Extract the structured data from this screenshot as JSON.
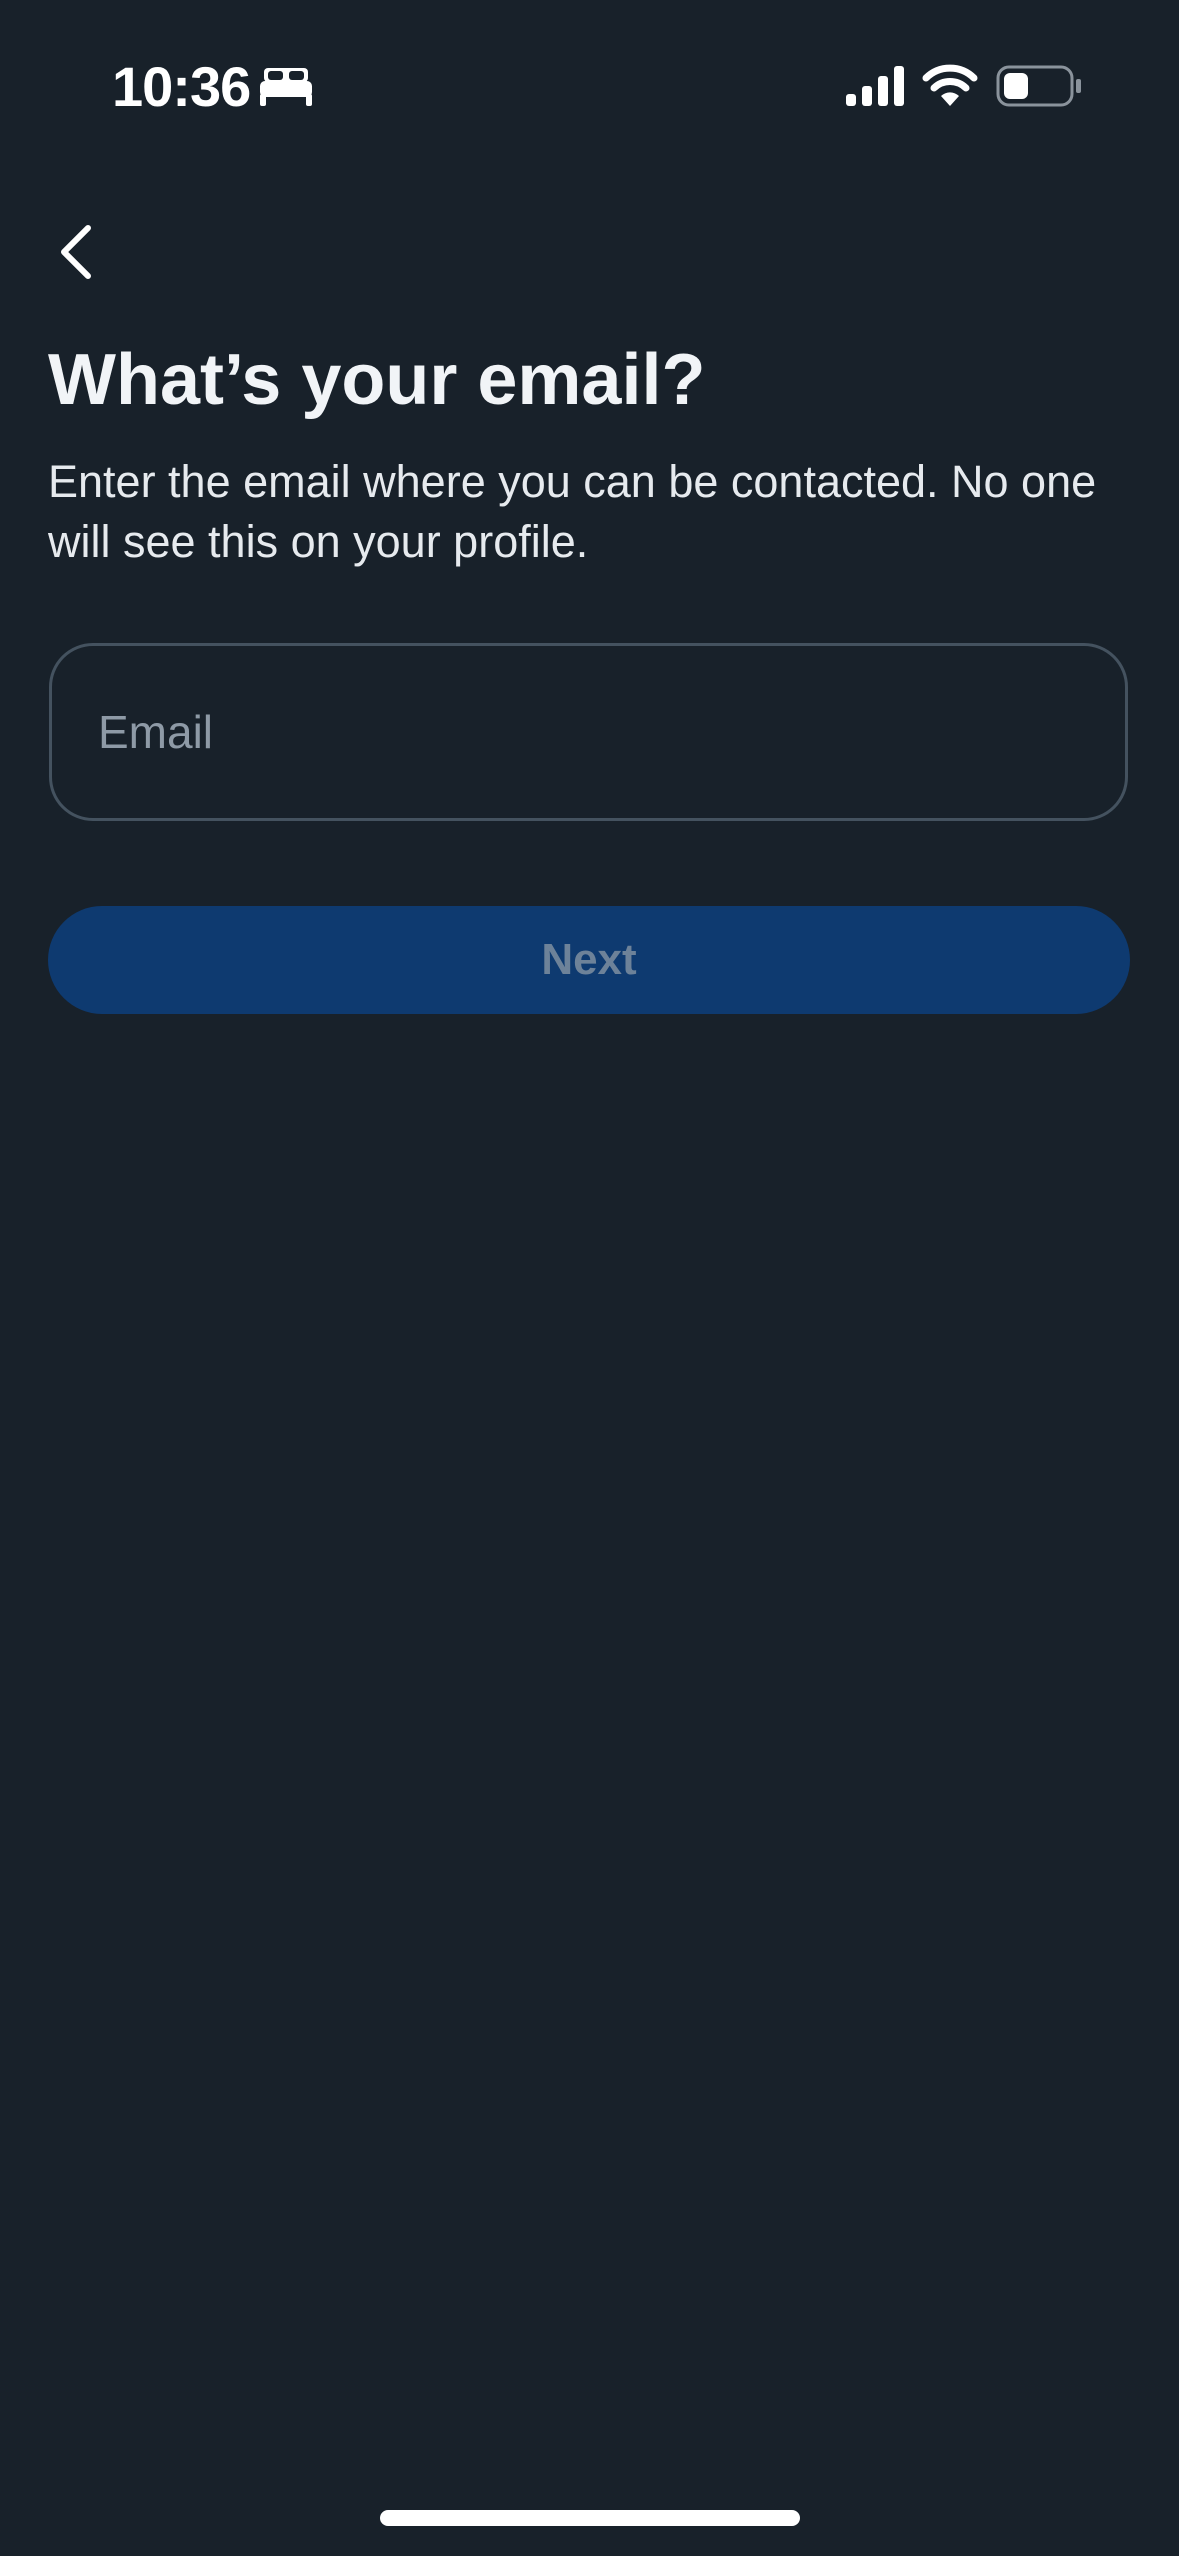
{
  "status_bar": {
    "time": "10:36",
    "icons": [
      "sleep-bed-icon",
      "cellular-signal-icon",
      "wifi-icon",
      "battery-icon"
    ]
  },
  "header": {
    "back_icon": "chevron-left-icon"
  },
  "main": {
    "title": "What’s your email?",
    "subtitle": "Enter the email where you can be contacted. No one will see this on your profile.",
    "email_input": {
      "value": "",
      "placeholder": "Email"
    },
    "next_button_label": "Next"
  },
  "colors": {
    "background": "#18212a",
    "primary_button": "#0e3a70",
    "primary_button_text_disabled": "#6d8299",
    "input_border": "#44525f"
  }
}
